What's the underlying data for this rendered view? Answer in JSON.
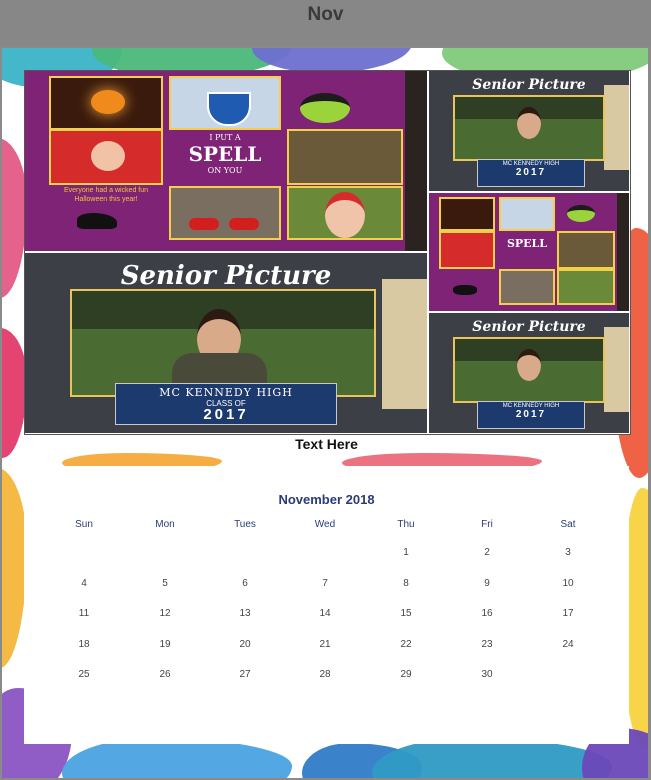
{
  "header": {
    "month_short": "Nov"
  },
  "collage": {
    "halloween": {
      "spell_line1": "I PUT A",
      "spell_line2": "SPELL",
      "spell_line3": "ON YOU",
      "caption": "Everyone had a wicked fun Halloween this year!"
    },
    "senior": {
      "title": "Senior Picture",
      "school": "MC KENNEDY HIGH",
      "class_label": "CLASS OF",
      "year": "2017"
    }
  },
  "caption": {
    "text": "Text Here"
  },
  "calendar": {
    "title": "November 2018",
    "weekdays": [
      "Sun",
      "Mon",
      "Tues",
      "Wed",
      "Thu",
      "Fri",
      "Sat"
    ],
    "weeks": [
      [
        "",
        "",
        "",
        "",
        "1",
        "2",
        "3"
      ],
      [
        "4",
        "5",
        "6",
        "7",
        "8",
        "9",
        "10"
      ],
      [
        "11",
        "12",
        "13",
        "14",
        "15",
        "16",
        "17"
      ],
      [
        "18",
        "19",
        "20",
        "21",
        "22",
        "23",
        "24"
      ],
      [
        "25",
        "26",
        "27",
        "28",
        "29",
        "30",
        ""
      ]
    ]
  },
  "colors": {
    "accent": "#2b3a7a",
    "halloween_bg": "#7e2376",
    "senior_bg": "#3c3f45",
    "banner": "#1c3a6e"
  }
}
